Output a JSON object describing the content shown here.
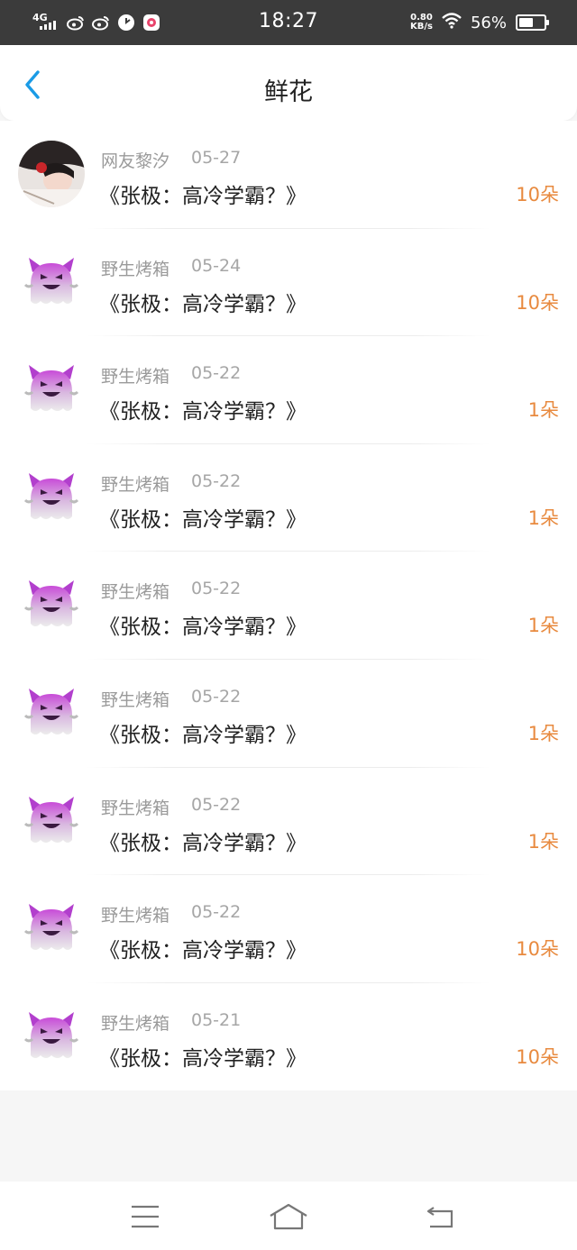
{
  "status_bar": {
    "network": "4G",
    "time": "18:27",
    "speed_value": "0.80",
    "speed_unit": "KB/s",
    "battery_percent": "56%",
    "battery_level": 0.56,
    "app_icons": [
      "weibo-icon",
      "weibo-icon",
      "clock-app-icon",
      "camera-app-icon"
    ]
  },
  "header": {
    "title": "鲜花",
    "back_icon": "chevron-left-icon"
  },
  "colors": {
    "accent_blue": "#1a9be6",
    "amount_orange": "#e88a3f",
    "status_bar_bg": "#3b3b3b"
  },
  "records": [
    {
      "name": "网友黎汐",
      "date": "05-27",
      "title": "《张极：高冷学霸？》",
      "amount": "10朵",
      "avatar": "profile-photo"
    },
    {
      "name": "野生烤箱",
      "date": "05-24",
      "title": "《张极：高冷学霸？》",
      "amount": "10朵",
      "avatar": "purple-ghost-icon"
    },
    {
      "name": "野生烤箱",
      "date": "05-22",
      "title": "《张极：高冷学霸？》",
      "amount": "1朵",
      "avatar": "purple-ghost-icon"
    },
    {
      "name": "野生烤箱",
      "date": "05-22",
      "title": "《张极：高冷学霸？》",
      "amount": "1朵",
      "avatar": "purple-ghost-icon"
    },
    {
      "name": "野生烤箱",
      "date": "05-22",
      "title": "《张极：高冷学霸？》",
      "amount": "1朵",
      "avatar": "purple-ghost-icon"
    },
    {
      "name": "野生烤箱",
      "date": "05-22",
      "title": "《张极：高冷学霸？》",
      "amount": "1朵",
      "avatar": "purple-ghost-icon"
    },
    {
      "name": "野生烤箱",
      "date": "05-22",
      "title": "《张极：高冷学霸？》",
      "amount": "1朵",
      "avatar": "purple-ghost-icon"
    },
    {
      "name": "野生烤箱",
      "date": "05-22",
      "title": "《张极：高冷学霸？》",
      "amount": "10朵",
      "avatar": "purple-ghost-icon"
    },
    {
      "name": "野生烤箱",
      "date": "05-21",
      "title": "《张极：高冷学霸？》",
      "amount": "10朵",
      "avatar": "purple-ghost-icon"
    }
  ],
  "bottom_nav": {
    "icons": [
      "menu-icon",
      "home-icon",
      "back-icon"
    ]
  }
}
